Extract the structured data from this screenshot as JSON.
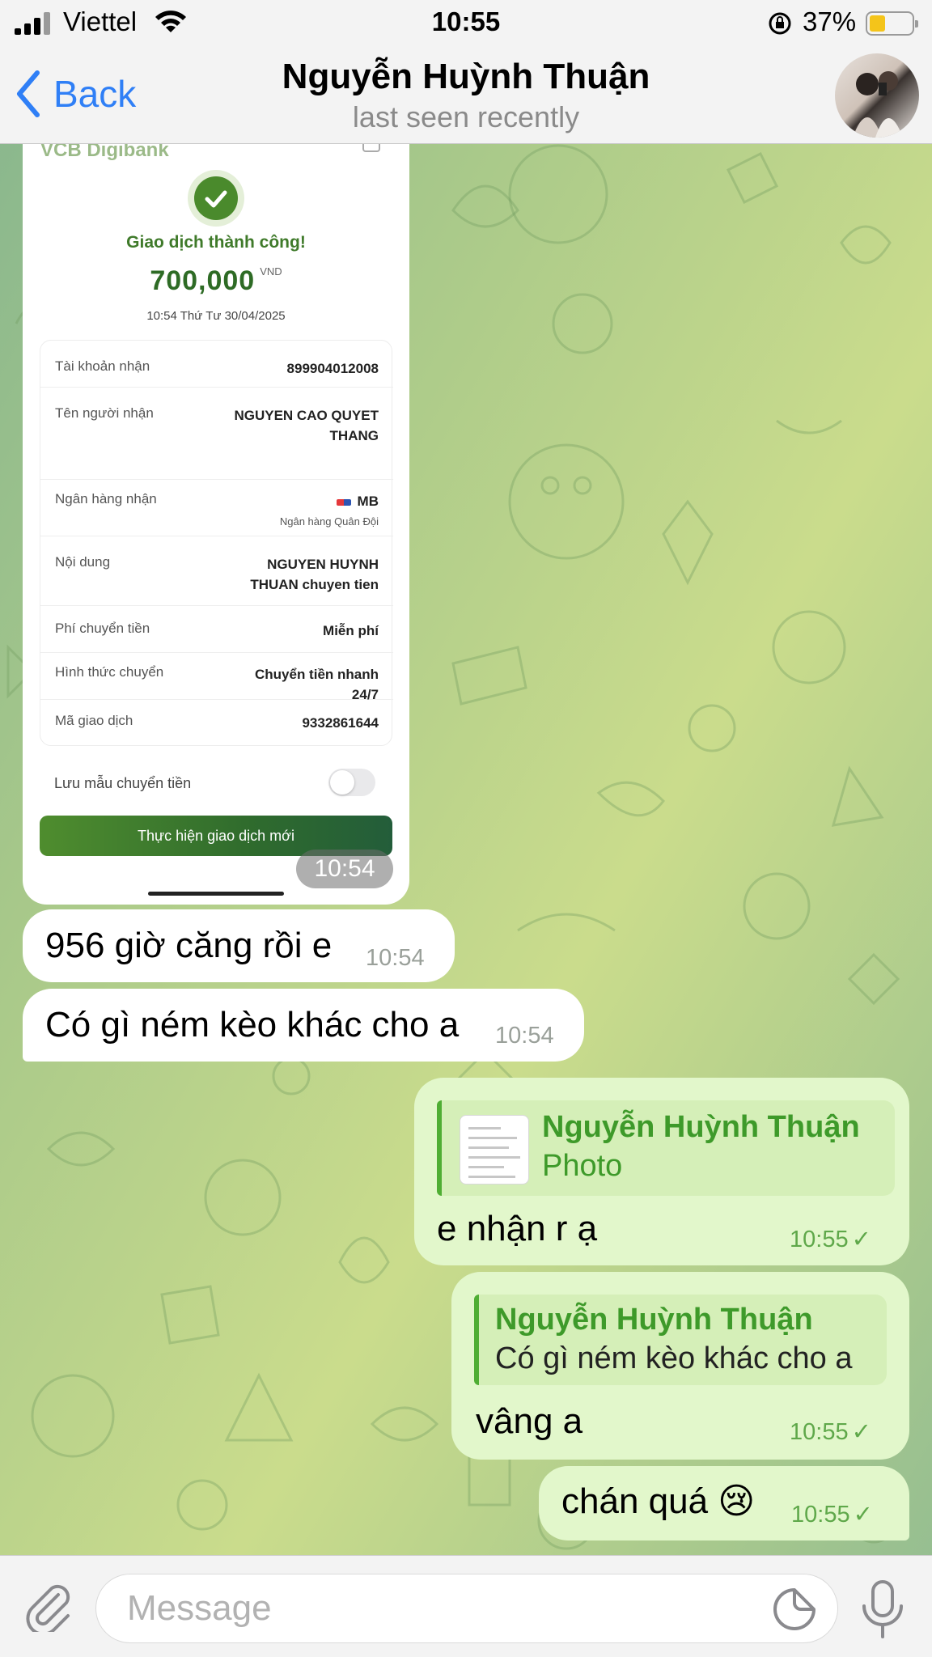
{
  "status_bar": {
    "carrier": "Viettel",
    "time": "10:55",
    "battery_percent": "37%",
    "battery_level": 0.37
  },
  "header": {
    "back_label": "Back",
    "contact_name": "Nguyễn Huỳnh Thuận",
    "status": "last seen recently"
  },
  "receipt": {
    "bank_logo": "VCB Digibank",
    "success_text": "Giao dịch thành công!",
    "amount": "700,000",
    "currency": "VND",
    "datetime": "10:54 Thứ Tư 30/04/2025",
    "rows": [
      {
        "label": "Tài khoản nhận",
        "value": "899904012008"
      },
      {
        "label": "Tên người nhận",
        "value": "NGUYEN CAO QUYET THANG"
      },
      {
        "label": "Ngân hàng nhận",
        "value": "MB",
        "sub": "Ngân hàng Quân Đội"
      },
      {
        "label": "Nội dung",
        "value": "NGUYEN HUYNH THUAN chuyen tien"
      },
      {
        "label": "Phí chuyển tiền",
        "value": "Miễn phí"
      },
      {
        "label": "Hình thức chuyển",
        "value": "Chuyển tiền nhanh 24/7"
      },
      {
        "label": "Mã giao dịch",
        "value": "9332861644"
      }
    ],
    "save_template_label": "Lưu mẫu chuyển tiền",
    "save_template_on": false,
    "new_transaction_button": "Thực hiện giao dịch mới",
    "time": "10:54"
  },
  "messages": {
    "in_1": {
      "text": "956 giờ căng rồi e",
      "time": "10:54"
    },
    "in_2": {
      "text": "Có gì ném kèo khác cho a",
      "time": "10:54"
    },
    "out_1": {
      "reply_name": "Nguyễn Huỳnh Thuận",
      "reply_text": "Photo",
      "text": "e nhận r ạ",
      "time": "10:55",
      "check": "✓"
    },
    "out_2": {
      "reply_name": "Nguyễn Huỳnh Thuận",
      "reply_text": "Có gì ném kèo khác cho a",
      "text": "vâng a",
      "time": "10:55",
      "check": "✓"
    },
    "out_3": {
      "text": "chán quá 😢",
      "time": "10:55",
      "check": "✓"
    }
  },
  "input": {
    "placeholder": "Message"
  },
  "icons": {
    "back": "chevron-left-icon",
    "attach": "paperclip-icon",
    "sticker": "sticker-icon",
    "mic": "microphone-icon"
  },
  "colors": {
    "accent": "#2f7ff6",
    "outgoing_bubble": "#e2f7cb",
    "outgoing_name": "#3e9a2a",
    "incoming_bubble": "#ffffff"
  }
}
